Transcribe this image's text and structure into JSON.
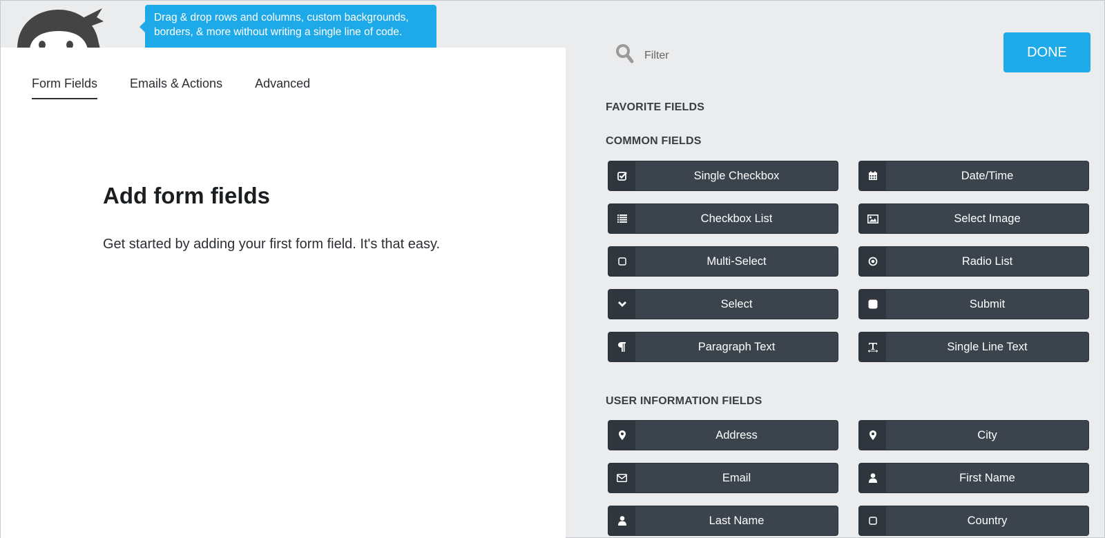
{
  "header": {
    "tooltip": "Drag & drop rows and columns, custom backgrounds, borders, & more without writing a single line of code."
  },
  "tabs": [
    {
      "label": "Form Fields",
      "active": true
    },
    {
      "label": "Emails & Actions",
      "active": false
    },
    {
      "label": "Advanced",
      "active": false
    }
  ],
  "main": {
    "title": "Add form fields",
    "description": "Get started by adding your first form field. It's that easy."
  },
  "sidebar": {
    "filter_placeholder": "Filter",
    "done_label": "DONE",
    "sections": [
      {
        "title": "FAVORITE FIELDS",
        "fields": []
      },
      {
        "title": "COMMON FIELDS",
        "fields": [
          {
            "label": "Single Checkbox",
            "icon": "checkbox-checked-icon"
          },
          {
            "label": "Date/Time",
            "icon": "calendar-icon"
          },
          {
            "label": "Checkbox List",
            "icon": "list-icon"
          },
          {
            "label": "Select Image",
            "icon": "image-icon"
          },
          {
            "label": "Multi-Select",
            "icon": "square-icon"
          },
          {
            "label": "Radio List",
            "icon": "radio-icon"
          },
          {
            "label": "Select",
            "icon": "chevron-down-icon"
          },
          {
            "label": "Submit",
            "icon": "filled-square-icon"
          },
          {
            "label": "Paragraph Text",
            "icon": "paragraph-icon"
          },
          {
            "label": "Single Line Text",
            "icon": "text-width-icon"
          }
        ]
      },
      {
        "title": "USER INFORMATION FIELDS",
        "fields": [
          {
            "label": "Address",
            "icon": "map-marker-icon"
          },
          {
            "label": "City",
            "icon": "map-marker-icon"
          },
          {
            "label": "Email",
            "icon": "envelope-icon"
          },
          {
            "label": "First Name",
            "icon": "user-icon"
          },
          {
            "label": "Last Name",
            "icon": "user-icon"
          },
          {
            "label": "Country",
            "icon": "square-icon"
          }
        ]
      }
    ]
  },
  "colors": {
    "accent": "#1ea9e8",
    "field_button": "#3b444d",
    "field_icon_bg": "#2f363d",
    "panel_bg": "#ebecee"
  }
}
